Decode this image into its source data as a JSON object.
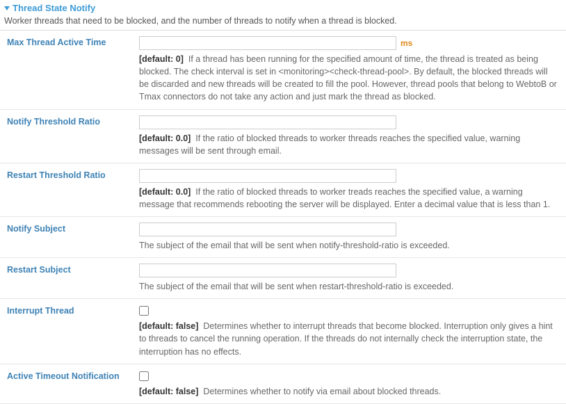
{
  "section": {
    "title": "Thread State Notify",
    "description": "Worker threads that need to be blocked, and the number of threads to notify when a thread is blocked."
  },
  "rows": {
    "maxThreadActiveTime": {
      "label": "Max Thread Active Time",
      "value": "",
      "unit": "ms",
      "default": "[default: 0]",
      "help": "If a thread has been running for the specified amount of time, the thread is treated as being blocked. The check interval is set in <monitoring><check-thread-pool>. By default, the blocked threads will be discarded and new threads will be created to fill the pool. However, thread pools that belong to WebtoB or Tmax connectors do not take any action and just mark the thread as blocked."
    },
    "notifyThresholdRatio": {
      "label": "Notify Threshold Ratio",
      "value": "",
      "default": "[default: 0.0]",
      "help": "If the ratio of blocked threads to worker threads reaches the specified value, warning messages will be sent through email."
    },
    "restartThresholdRatio": {
      "label": "Restart Threshold Ratio",
      "value": "",
      "default": "[default: 0.0]",
      "help": "If the ratio of blocked threads to worker treads reaches the specified value, a warning message that recommends rebooting the server will be displayed. Enter a decimal value that is less than 1."
    },
    "notifySubject": {
      "label": "Notify Subject",
      "value": "",
      "help": "The subject of the email that will be sent when notify-threshold-ratio is exceeded."
    },
    "restartSubject": {
      "label": "Restart Subject",
      "value": "",
      "help": "The subject of the email that will be sent when restart-threshold-ratio is exceeded."
    },
    "interruptThread": {
      "label": "Interrupt Thread",
      "default": "[default: false]",
      "help": "Determines whether to interrupt threads that become blocked. Interruption only gives a hint to threads to cancel the running operation. If the threads do not internally check the interruption state, the interruption has no effects."
    },
    "activeTimeoutNotification": {
      "label": "Active Timeout Notification",
      "default": "[default: false]",
      "help": "Determines whether to notify via email about blocked threads."
    }
  }
}
